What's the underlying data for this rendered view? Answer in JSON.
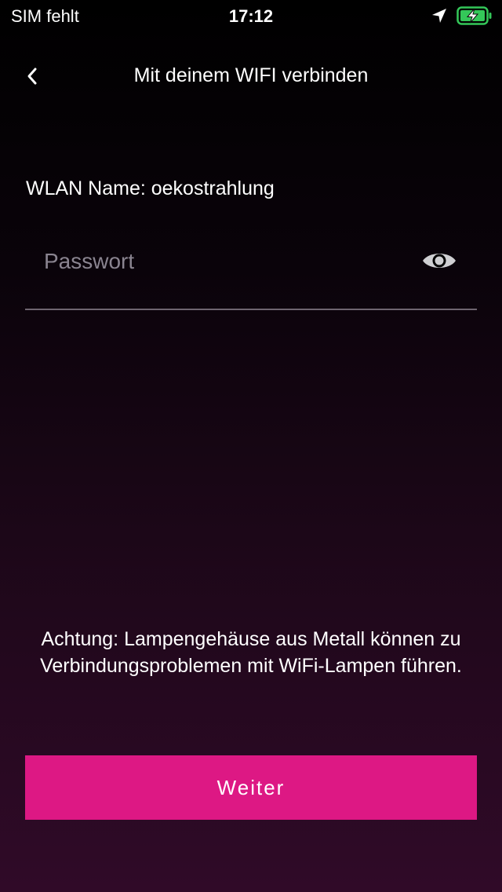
{
  "status_bar": {
    "carrier": "SIM fehlt",
    "time": "17:12",
    "location_icon": "location-arrow-icon",
    "battery_icon": "battery-charging-icon",
    "battery_color": "#34c759"
  },
  "nav": {
    "back_icon": "chevron-left-icon",
    "title": "Mit deinem WIFI verbinden"
  },
  "form": {
    "wlan_label": "WLAN Name: oekostrahlung",
    "password": {
      "value": "",
      "placeholder": "Passwort",
      "toggle_icon": "eye-icon"
    }
  },
  "warning": "Achtung: Lampengehäuse aus Metall können zu Verbindungsproblemen mit WiFi-Lampen führen.",
  "next_button": {
    "label": "Weiter",
    "color": "#dd1884"
  }
}
